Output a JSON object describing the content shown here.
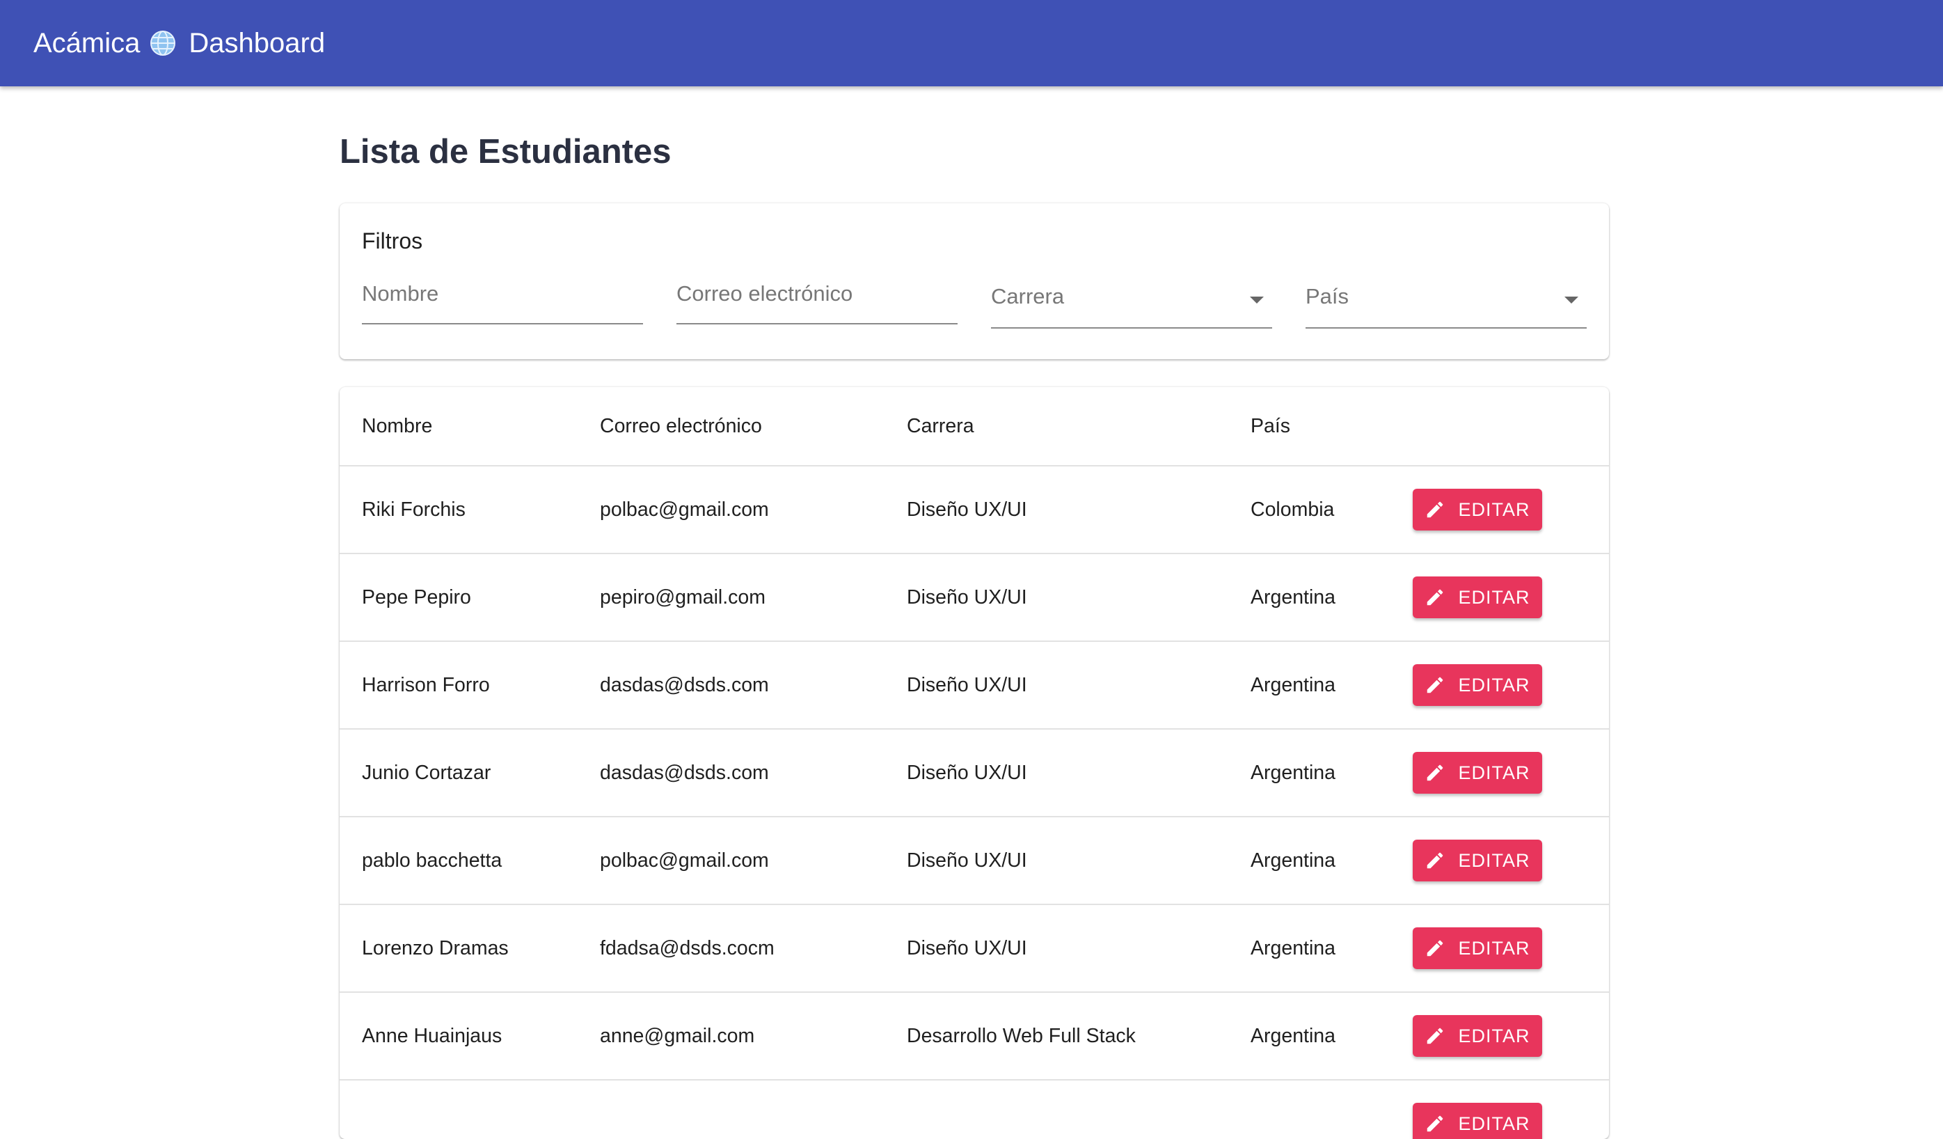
{
  "header": {
    "brand_left": "Acámica",
    "brand_icon": "globe-icon",
    "brand_right": "Dashboard",
    "color": "#3f51b5"
  },
  "page": {
    "title": "Lista de Estudiantes"
  },
  "filters": {
    "title": "Filtros",
    "nombre_placeholder": "Nombre",
    "correo_placeholder": "Correo electrónico",
    "carrera_label": "Carrera",
    "pais_label": "País"
  },
  "table": {
    "columns": [
      "Nombre",
      "Correo electrónico",
      "Carrera",
      "País"
    ],
    "edit_label": "EDITAR",
    "edit_color": "#e8355c",
    "rows": [
      {
        "nombre": "Riki Forchis",
        "correo": "polbac@gmail.com",
        "carrera": "Diseño UX/UI",
        "pais": "Colombia"
      },
      {
        "nombre": "Pepe Pepiro",
        "correo": "pepiro@gmail.com",
        "carrera": "Diseño UX/UI",
        "pais": "Argentina"
      },
      {
        "nombre": "Harrison Forro",
        "correo": "dasdas@dsds.com",
        "carrera": "Diseño UX/UI",
        "pais": "Argentina"
      },
      {
        "nombre": "Junio Cortazar",
        "correo": "dasdas@dsds.com",
        "carrera": "Diseño UX/UI",
        "pais": "Argentina"
      },
      {
        "nombre": "pablo bacchetta",
        "correo": "polbac@gmail.com",
        "carrera": "Diseño UX/UI",
        "pais": "Argentina"
      },
      {
        "nombre": "Lorenzo Dramas",
        "correo": "fdadsa@dsds.cocm",
        "carrera": "Diseño UX/UI",
        "pais": "Argentina"
      },
      {
        "nombre": "Anne Huainjaus",
        "correo": "anne@gmail.com",
        "carrera": "Desarrollo Web Full Stack",
        "pais": "Argentina"
      },
      {
        "nombre": "",
        "correo": "",
        "carrera": "",
        "pais": ""
      }
    ]
  }
}
